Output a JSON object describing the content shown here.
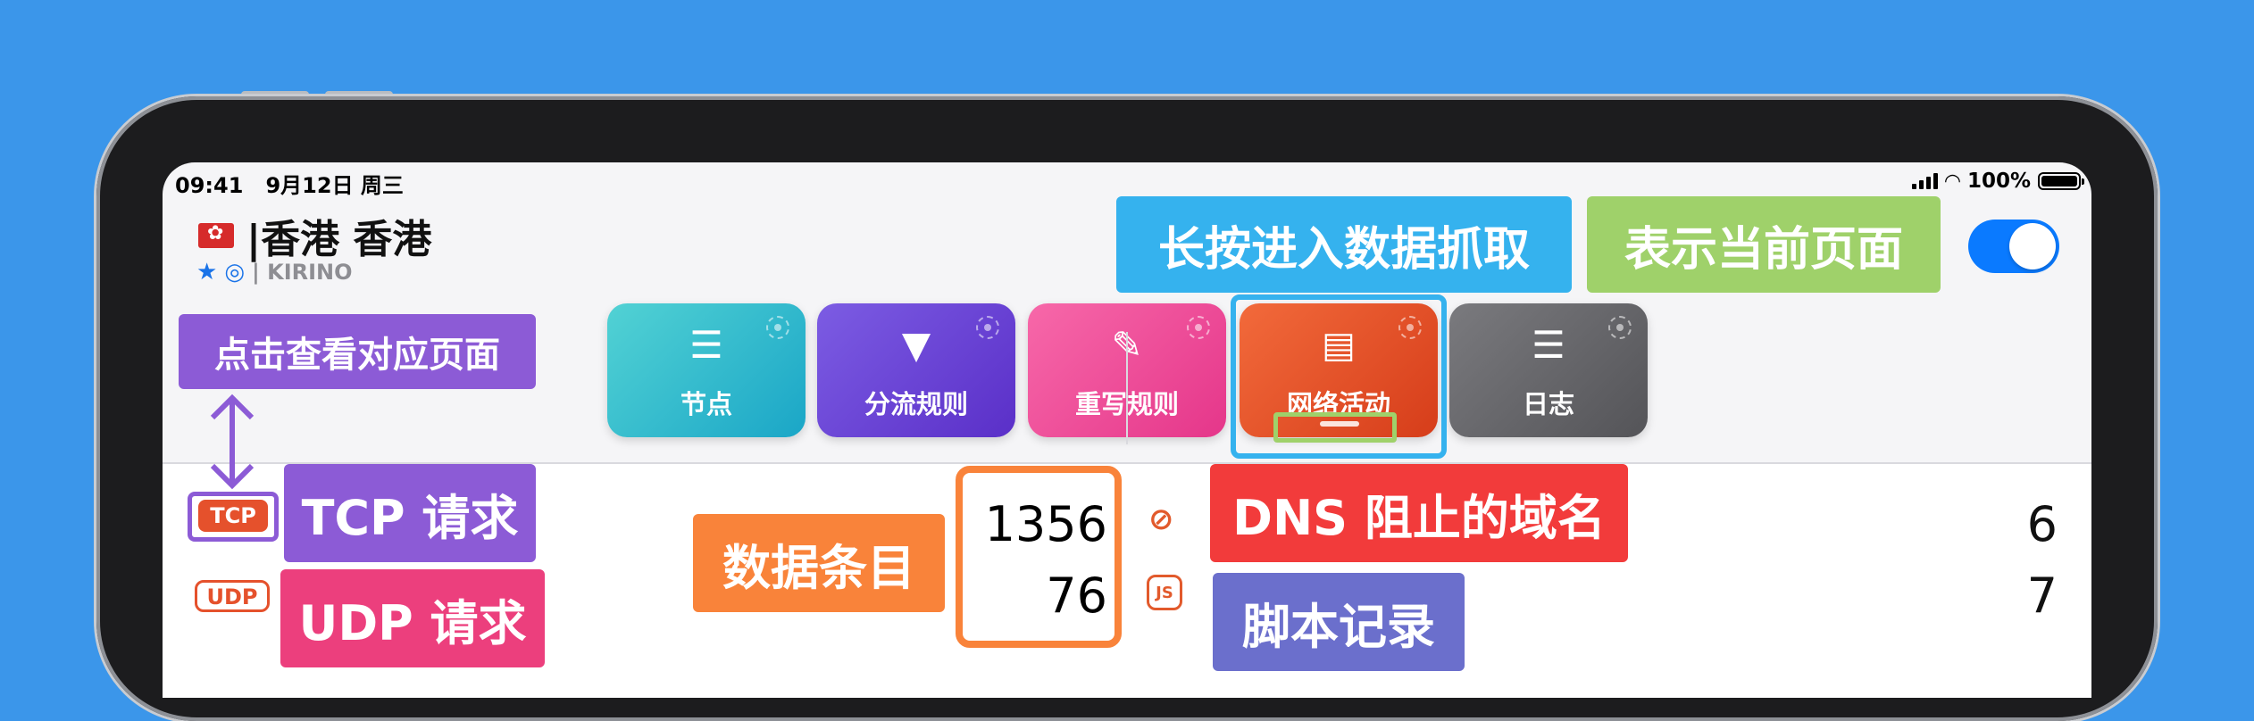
{
  "status_bar": {
    "time": "09:41",
    "date": "9月12日 周三",
    "battery": "100%",
    "battery_level": 1.0
  },
  "header": {
    "title": "|香港 香港",
    "subtitle": "| KIRINO",
    "toggle_on": true
  },
  "tiles": [
    {
      "label": "节点",
      "icon": "server-icon",
      "glyph": "☰"
    },
    {
      "label": "分流规则",
      "icon": "filter-icon",
      "glyph": "▼"
    },
    {
      "label": "重写规则",
      "icon": "pencil-icon",
      "glyph": "✎"
    },
    {
      "label": "网络活动",
      "icon": "clipboard-icon",
      "glyph": "📋"
    },
    {
      "label": "日志",
      "icon": "lines-icon",
      "glyph": "☰"
    }
  ],
  "stats": {
    "tcp_badge": "TCP",
    "udp_badge": "UDP",
    "tcp_count": "1356",
    "udp_count": "76",
    "dns_blocked_count": "6",
    "script_count": "7",
    "js_badge": "JS"
  },
  "annotations": {
    "long_press": "长按进入数据抓取",
    "current_page": "表示当前页面",
    "click_view": "点击查看对应页面",
    "tcp_request": "TCP 请求",
    "udp_request": "UDP 请求",
    "data_entries": "数据条目",
    "dns_blocked": "DNS 阻止的域名",
    "script_log": "脚本记录"
  },
  "colors": {
    "background": "#3b96ea",
    "annotation_blue": "#35b2ee",
    "annotation_green": "#9fd16a",
    "annotation_purple": "#8c5bd6",
    "annotation_pink": "#ec3f7d",
    "annotation_orange": "#f9833a",
    "annotation_red": "#f23b3b",
    "annotation_slate": "#6b6fcc"
  }
}
